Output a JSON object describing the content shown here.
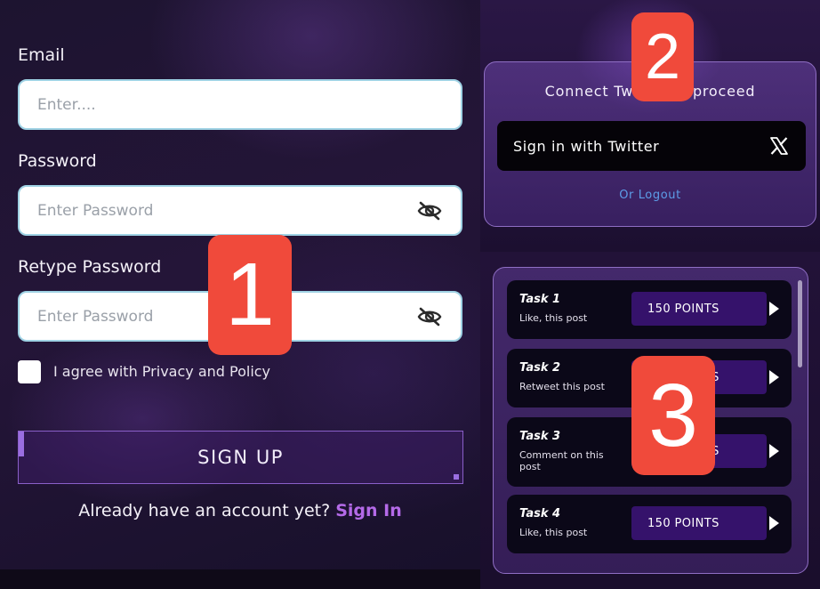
{
  "signup_form": {
    "email_label": "Email",
    "email_placeholder": "Enter....",
    "password_label": "Password",
    "password_placeholder": "Enter Password",
    "retype_label": "Retype Password",
    "retype_placeholder": "Enter Password",
    "agree_text": "I agree with Privacy and Policy",
    "signup_button": "SIGN UP",
    "have_account_text": "Already have an account yet?",
    "signin_link": "Sign In"
  },
  "connect": {
    "title": "Connect Twitter to proceed",
    "twitter_button": "Sign in with Twitter",
    "logout_link": "Or Logout"
  },
  "tasks": [
    {
      "name": "Task 1",
      "description": "Like, this post",
      "points": "150 POINTS"
    },
    {
      "name": "Task 2",
      "description": "Retweet this post",
      "points": "150 POINTS"
    },
    {
      "name": "Task 3",
      "description": "Comment on this post",
      "points": "150 POINTS"
    },
    {
      "name": "Task 4",
      "description": "Like, this post",
      "points": "150 POINTS"
    }
  ],
  "badges": [
    "1",
    "2",
    "3"
  ],
  "icons": {
    "eye_off": "eye-off-icon",
    "x_logo": "x-logo-icon",
    "play": "play-icon"
  },
  "colors": {
    "accent_purple": "#b46ae8",
    "points_bg": "#35126b",
    "badge_red": "#f04a3b",
    "logout_blue": "#5d9de8"
  }
}
